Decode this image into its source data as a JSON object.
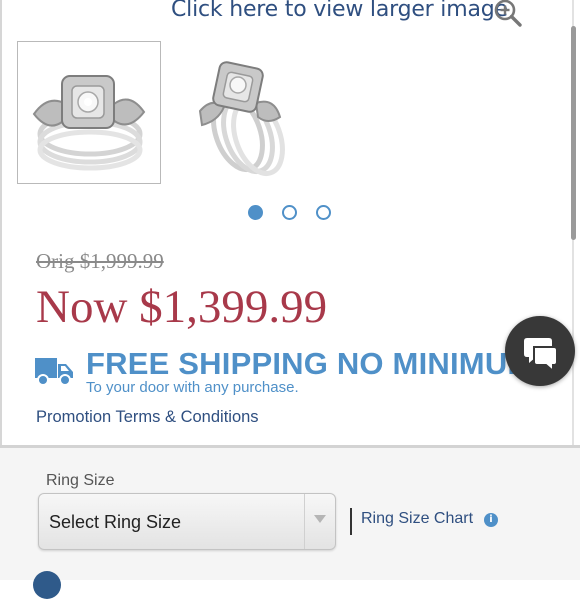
{
  "header": {
    "view_larger_text": "Click here to view larger image",
    "zoom_icon": "zoom-in-icon"
  },
  "gallery": {
    "thumbnails": [
      {
        "label": "ring-set-front-view",
        "selected": true
      },
      {
        "label": "ring-set-angled-view",
        "selected": false
      }
    ],
    "pagination": {
      "total": 3,
      "current": 1
    }
  },
  "pricing": {
    "original": "Orig $1,999.99",
    "current": "Now $1,399.99"
  },
  "shipping": {
    "icon": "delivery-truck-icon",
    "headline": "FREE SHIPPING NO MINIMUM",
    "subtext": "To your door with any purchase."
  },
  "chat": {
    "icon": "chat-bubbles-icon"
  },
  "promotion": {
    "link_text": "Promotion Terms & Conditions"
  },
  "ring_size": {
    "label": "Ring Size",
    "select_value": "Select Ring Size",
    "chart_link": "Ring Size Chart",
    "info_icon": "info-icon"
  },
  "colors": {
    "accent_blue": "#4f90c8",
    "link_navy": "#2f4f80",
    "price_red": "#a8394a",
    "strike_gray": "#8a8a8a"
  }
}
